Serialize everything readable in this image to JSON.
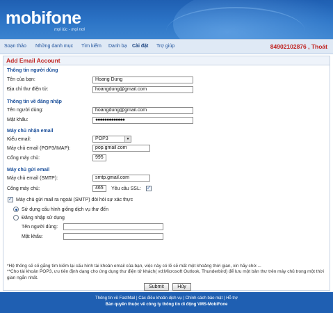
{
  "header": {
    "logo": "mobifone",
    "slogan": "mọi lúc - mọi nơi"
  },
  "nav": {
    "items": [
      {
        "label": "Soạn thảo"
      },
      {
        "label": "Những danh mục"
      },
      {
        "label": "Tìm kiếm"
      },
      {
        "label": "Danh bạ"
      },
      {
        "label": "Cài đặt",
        "active": true
      },
      {
        "label": "Trợ giúp"
      }
    ],
    "account": "84902102876 , Thoát"
  },
  "form": {
    "title": "Add Email Account",
    "user_info": {
      "heading": "Thông tin người dùng",
      "name_label": "Tên của bạn:",
      "name_value": "Hoang Dung",
      "email_label": "Địa chỉ thư điện tử:",
      "email_value": "hoangdung@gmail.com"
    },
    "login_info": {
      "heading": "Thông tin về đăng nhập",
      "username_label": "Tên người dùng:",
      "username_value": "hoangdung@gmail.com",
      "password_label": "Mật khẩu:",
      "password_value": "●●●●●●●●●●●●●"
    },
    "incoming": {
      "heading": "Máy chủ nhận email",
      "type_label": "Kiểu email:",
      "type_value": "POP3",
      "server_label": "Máy chủ email (POP3/IMAP):",
      "server_value": "pop.gmail.com",
      "port_label": "Cổng máy chủ:",
      "port_value": "995"
    },
    "outgoing": {
      "heading": "Máy chủ gửi email",
      "server_label": "Máy chủ email (SMTP):",
      "server_value": "smtp.gmail.com",
      "port_label": "Cổng máy chủ:",
      "port_value": "465",
      "ssl_label": "Yêu cầu SSL:",
      "ssl_checked": true
    },
    "smtp_auth": {
      "label": "Máy chủ gửi mail ra ngoài (SMTP) đòi hỏi sự xác thực",
      "checked": true,
      "option_same": "Sử dụng cấu hình giống dịch vụ thư đến",
      "option_login": "Đăng nhập sử dụng",
      "selected": "same",
      "username_label": "Tên người dùng:",
      "username_value": "",
      "password_label": "Mật khẩu:",
      "password_value": ""
    },
    "note_1": "*Hệ thống sẽ cố gắng tìm kiếm lại cấu hình tài khoản email của bạn, việc này có lẽ sẽ mất một khoảng thời gian, xin hãy chờ....",
    "note_2": "**Cho tài khoản POP3, ưu tiên định dạng cho ứng dụng thư điện tử khách( vd:Microsoft Outlook, Thunderbird) để lưu một bản thư trên máy chủ trong một thời gian ngắn nhất.",
    "submit_label": "Submit",
    "cancel_label": "Hủy"
  },
  "footer": {
    "links": "Thông tin về FastMail | Các điều khoản dịch vụ | Chính sách bảo mật | Hỗ trợ",
    "copyright": "Bản quyền thuộc về công ty thông tin di động VMS-MobiFone"
  },
  "colors": {
    "brand_blue": "#1f5fb2",
    "title_red": "#c0221f",
    "section_blue": "#1b4f9a"
  }
}
